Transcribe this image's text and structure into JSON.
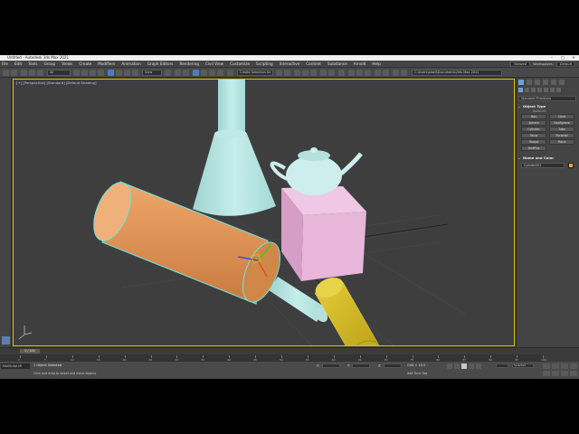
{
  "window": {
    "title": "Untitled - Autodesk 3ds Max 2021",
    "controls": [
      "–",
      "□",
      "✕"
    ]
  },
  "menu": {
    "items": [
      "File",
      "Edit",
      "Tools",
      "Group",
      "Views",
      "Create",
      "Modifiers",
      "Animation",
      "Graph Editors",
      "Rendering",
      "Civil View",
      "Customize",
      "Scripting",
      "Interactive",
      "Content",
      "Substance",
      "Arnold",
      "Help"
    ],
    "user": "Skewed",
    "workspace_label": "Workspaces:",
    "workspace_value": "Default"
  },
  "toolbar": {
    "filter_value": "All",
    "view_value": "View",
    "selection_set": "Create Selection Se",
    "project_path": "C:\\Users\\sewil\\Documents\\3ds Max 2021"
  },
  "viewport": {
    "label": "[+] [Perspective] [Standard] [Default Shading]",
    "objects": [
      "teapot",
      "cone",
      "box",
      "cylinder",
      "capsule",
      "pipe"
    ]
  },
  "command_panel": {
    "category_value": "Standard Primitives",
    "object_type": {
      "header": "Object Type",
      "autogrid": "AutoGrid",
      "buttons": [
        "Box",
        "Cone",
        "Sphere",
        "GeoSphere",
        "Cylinder",
        "Tube",
        "Torus",
        "Pyramid",
        "Teapot",
        "Plane",
        "TextPlus"
      ]
    },
    "name_and_color": {
      "header": "Name and Color",
      "name_value": "Cylinder001",
      "color": "#e6a64a"
    }
  },
  "timeline": {
    "frame_label": "0 / 100",
    "ticks": [
      "0",
      "5",
      "10",
      "15",
      "20",
      "25",
      "30",
      "35",
      "40",
      "45",
      "50",
      "55",
      "60",
      "65",
      "70",
      "75",
      "80",
      "85",
      "90",
      "95",
      "100"
    ]
  },
  "status": {
    "maxscript": "MAXScript Mi",
    "selected": "1 Object Selected",
    "prompt": "Click and drag to select and move objects",
    "x_label": "X:",
    "y_label": "Y:",
    "z_label": "Z:",
    "grid": "Grid = 10.0",
    "add_time_tag": "Add Time Tag",
    "key_filter": "Selected"
  },
  "colors": {
    "accent": "#4a7ec4",
    "viewport_border": "#e0c000",
    "selected_cylinder": "#d98f50",
    "yellow_cylinder": "#d9c12a",
    "pink_box": "#e6b3d8",
    "teal_objects": "#b5e3e0"
  }
}
